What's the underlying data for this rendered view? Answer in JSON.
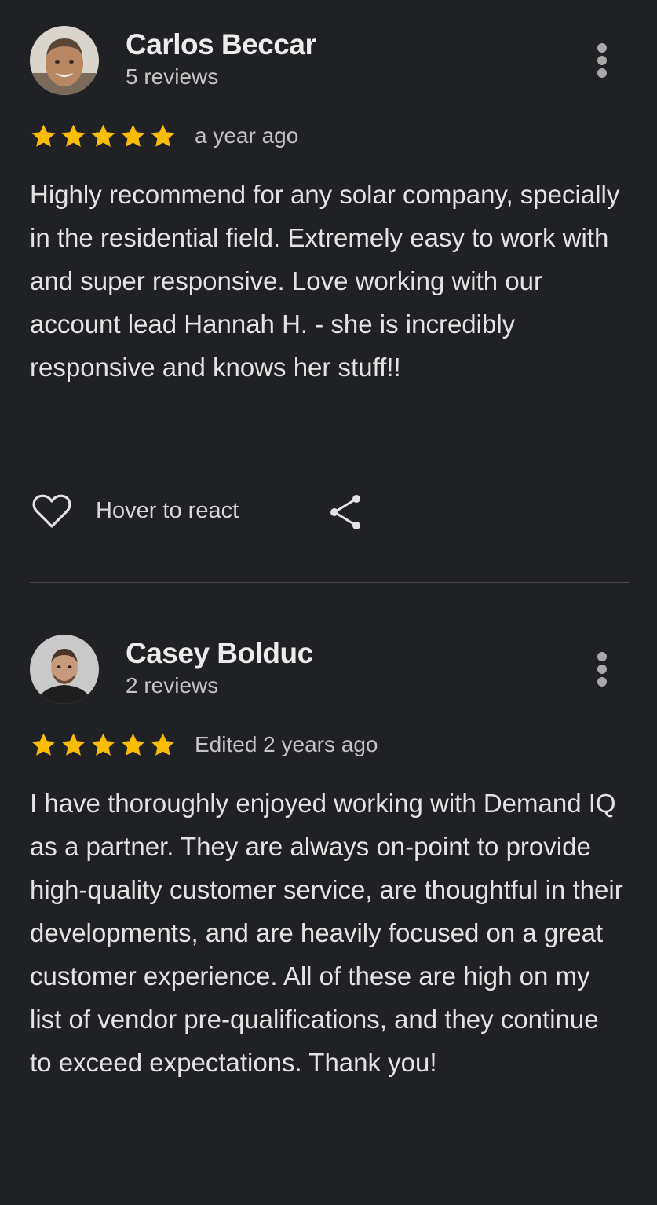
{
  "reviews": [
    {
      "author": "Carlos Beccar",
      "review_count": "5 reviews",
      "rating": 5,
      "time": "a year ago",
      "text": "Highly recommend for any solar company, specially in the residential field. Extremely easy to work with and super responsive. Love working with our account lead Hannah H. - she is incredibly responsive and knows her stuff!!",
      "react_label": "Hover to react",
      "icons": [
        "avatar",
        "more-vert-icon",
        "star-icon",
        "heart-icon",
        "share-icon"
      ]
    },
    {
      "author": "Casey Bolduc",
      "review_count": "2 reviews",
      "rating": 5,
      "time": "Edited 2 years ago",
      "text": "I have thoroughly enjoyed working with Demand IQ as a partner. They are always on-point to provide high-quality customer service, are thoughtful in their developments, and are heavily focused on a great customer experience. All of these are high on my list of vendor pre-qualifications, and they continue to exceed expectations. Thank you!",
      "icons": [
        "avatar",
        "more-vert-icon",
        "star-icon"
      ]
    }
  ],
  "colors": {
    "background": "#202124",
    "star": "#fbbc04",
    "text_primary": "#e8eaed",
    "text_secondary": "#c4c4c4"
  }
}
